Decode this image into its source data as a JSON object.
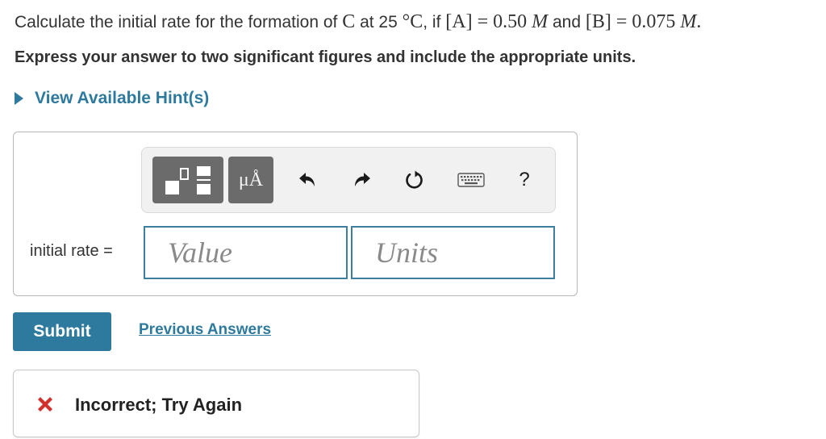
{
  "question": {
    "prefix": "Calculate the initial rate for the formation of ",
    "species": "C",
    "at": " at 25 ",
    "temp_unit": "°C",
    "if_text": ", if ",
    "conc_a_label": "[A]",
    "eq1": " = 0.50 ",
    "molar1": "M",
    "and_text": " and ",
    "conc_b_label": "[B]",
    "eq2": " = 0.075 ",
    "molar2": "M",
    "end": "."
  },
  "instruction": "Express your answer to two significant figures and include the appropriate units.",
  "hint_link": "View Available Hint(s)",
  "toolbar": {
    "units_symbol": "μÅ",
    "help_symbol": "?",
    "icons": [
      "templates-icon",
      "units-icon",
      "undo-icon",
      "redo-icon",
      "reset-icon",
      "keyboard-icon",
      "help-icon"
    ]
  },
  "answer": {
    "label": "initial rate =",
    "value_placeholder": "Value",
    "units_placeholder": "Units"
  },
  "buttons": {
    "submit": "Submit",
    "previous_answers": "Previous Answers"
  },
  "feedback": {
    "message": "Incorrect; Try Again",
    "status_color": "#d0312d"
  },
  "colors": {
    "accent": "#2e7a9e",
    "toolbar_button": "#6b6b6b",
    "input_border": "#3d7fa3"
  }
}
